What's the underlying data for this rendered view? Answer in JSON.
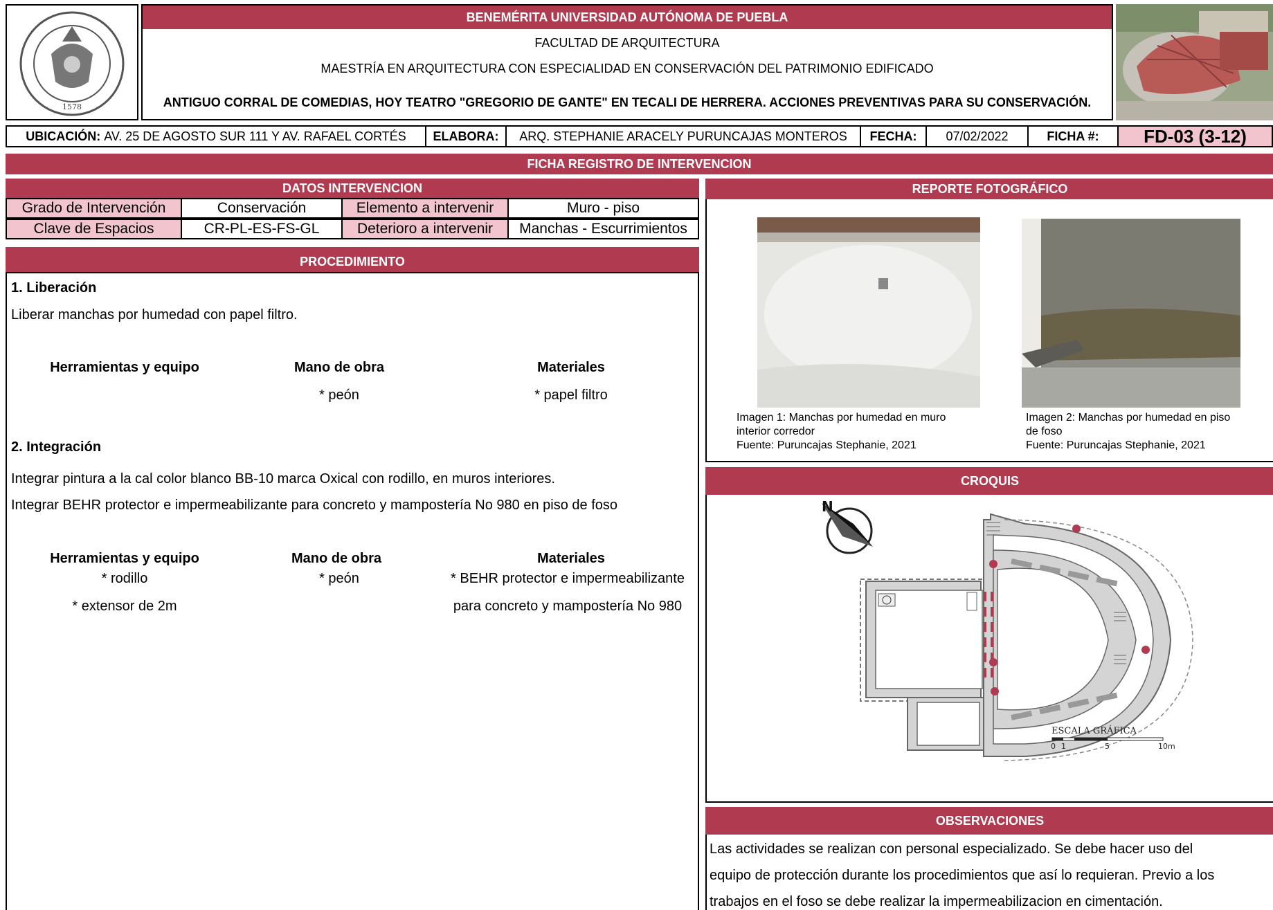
{
  "header": {
    "university": "BENEMÉRITA UNIVERSIDAD AUTÓNOMA DE PUEBLA",
    "faculty": "FACULTAD DE ARQUITECTURA",
    "program": "MAESTRÍA EN  ARQUITECTURA CON ESPECIALIDAD EN CONSERVACIÓN DEL PATRIMONIO EDIFICADO",
    "project": "ANTIGUO CORRAL DE COMEDIAS, HOY TEATRO \"GREGORIO DE GANTE\" EN TECALI DE HERRERA. ACCIONES PREVENTIVAS PARA SU CONSERVACIÓN.",
    "seal_year": "1578"
  },
  "info": {
    "ubicacion_label": "UBICACIÓN:",
    "ubicacion_value": "AV. 25 DE AGOSTO SUR 111 Y AV. RAFAEL CORTÉS",
    "elabora_label": "ELABORA:",
    "elabora_value": "ARQ. STEPHANIE ARACELY PURUNCAJAS MONTEROS",
    "fecha_label": "FECHA:",
    "fecha_value": "07/02/2022",
    "ficha_label": "FICHA #:",
    "ficha_value": "FD-03 (3-12)"
  },
  "title_bar": "FICHA REGISTRO DE INTERVENCION",
  "datos": {
    "title": "DATOS INTERVENCION",
    "grado_label": "Grado de Intervención",
    "grado_value": "Conservación",
    "elemento_label": "Elemento a intervenir",
    "elemento_value": "Muro - piso",
    "clave_label": "Clave de Espacios",
    "clave_value": "CR-PL-ES-FS-GL",
    "deterioro_label": "Deterioro a intervenir",
    "deterioro_value": "Manchas - Escurrimientos"
  },
  "procedimiento": {
    "title": "PROCEDIMIENTO",
    "step1_title": "1. Liberación",
    "step1_text": "Liberar manchas por humedad con papel filtro.",
    "step1_h1": "Herramientas y equipo",
    "step1_h2": "Mano de obra",
    "step1_h3": "Materiales",
    "step1_mano": "* peón",
    "step1_mat": "* papel filtro",
    "step2_title": "2. Integración",
    "step2_text1": "Integrar pintura a la cal color blanco BB-10 marca Oxical con rodillo, en muros interiores.",
    "step2_text2": "Integrar BEHR protector e impermeabilizante para concreto y mampostería No 980 en piso de foso",
    "step2_h1": "Herramientas y equipo",
    "step2_h2": "Mano de obra",
    "step2_h3": "Materiales",
    "step2_tool1": "* rodillo",
    "step2_tool2": "* extensor de 2m",
    "step2_mano": "* peón",
    "step2_mat1": "* BEHR protector e impermeabilizante",
    "step2_mat2": "para concreto y mampostería No 980"
  },
  "reporte": {
    "title": "REPORTE FOTOGRÁFICO",
    "img1_caption1": "Imagen 1: Manchas por humedad en muro",
    "img1_caption2": "interior corredor",
    "img1_source": "Fuente: Puruncajas Stephanie, 2021",
    "img2_caption1": "Imagen 2: Manchas por humedad en piso",
    "img2_caption2": "de foso",
    "img2_source": "Fuente: Puruncajas Stephanie, 2021"
  },
  "croquis": {
    "title": "CROQUIS",
    "north": "N",
    "scale_title": "ESCALA GRÁFICA",
    "scale_0": "0",
    "scale_1": "1",
    "scale_5": "5",
    "scale_10": "10m"
  },
  "observaciones": {
    "title": "OBSERVACIONES",
    "line1": "Las actividades se realizan con personal especializado. Se debe hacer uso del",
    "line2": "equipo de protección durante los procedimientos que así lo requieran. Previo a los",
    "line3": "trabajos en el foso se debe realizar la impermeabilizacion en cimentación."
  },
  "colors": {
    "accent": "#b03a50",
    "label_fill": "#f2c4cd",
    "marker": "#b03a50"
  }
}
